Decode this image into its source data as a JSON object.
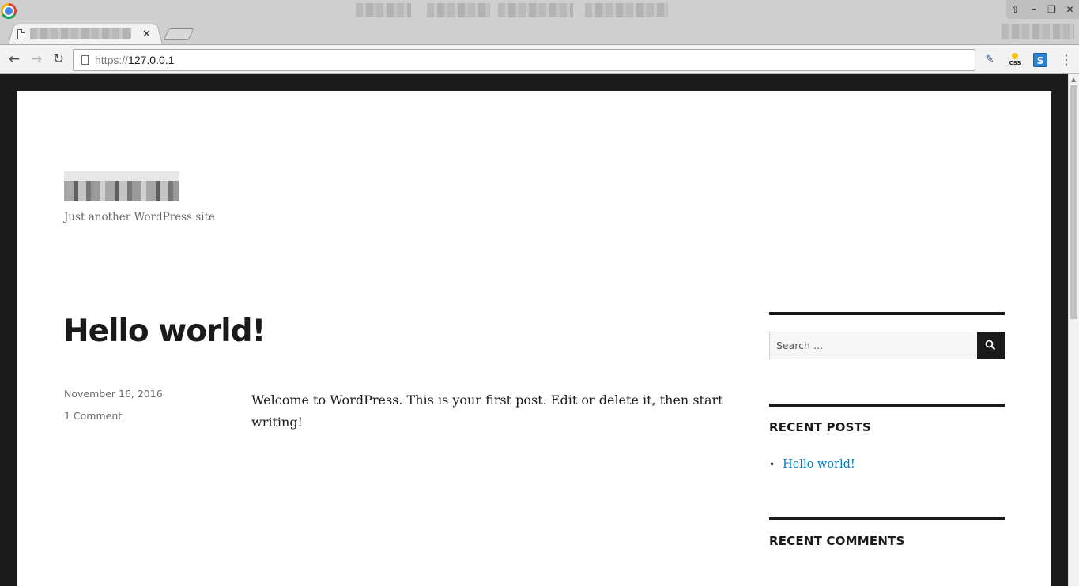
{
  "browser": {
    "address": {
      "scheme": "https://",
      "host": "127.0.0.1"
    }
  },
  "site": {
    "description": "Just another WordPress site"
  },
  "post": {
    "title": "Hello world!",
    "date": "November 16, 2016",
    "comments": "1 Comment",
    "content": "Welcome to WordPress. This is your first post. Edit or delete it, then start writing!"
  },
  "sidebar": {
    "search_placeholder": "Search …",
    "recent_posts_title": "RECENT POSTS",
    "recent_posts": [
      "Hello world!"
    ],
    "recent_comments_title": "RECENT COMMENTS"
  }
}
